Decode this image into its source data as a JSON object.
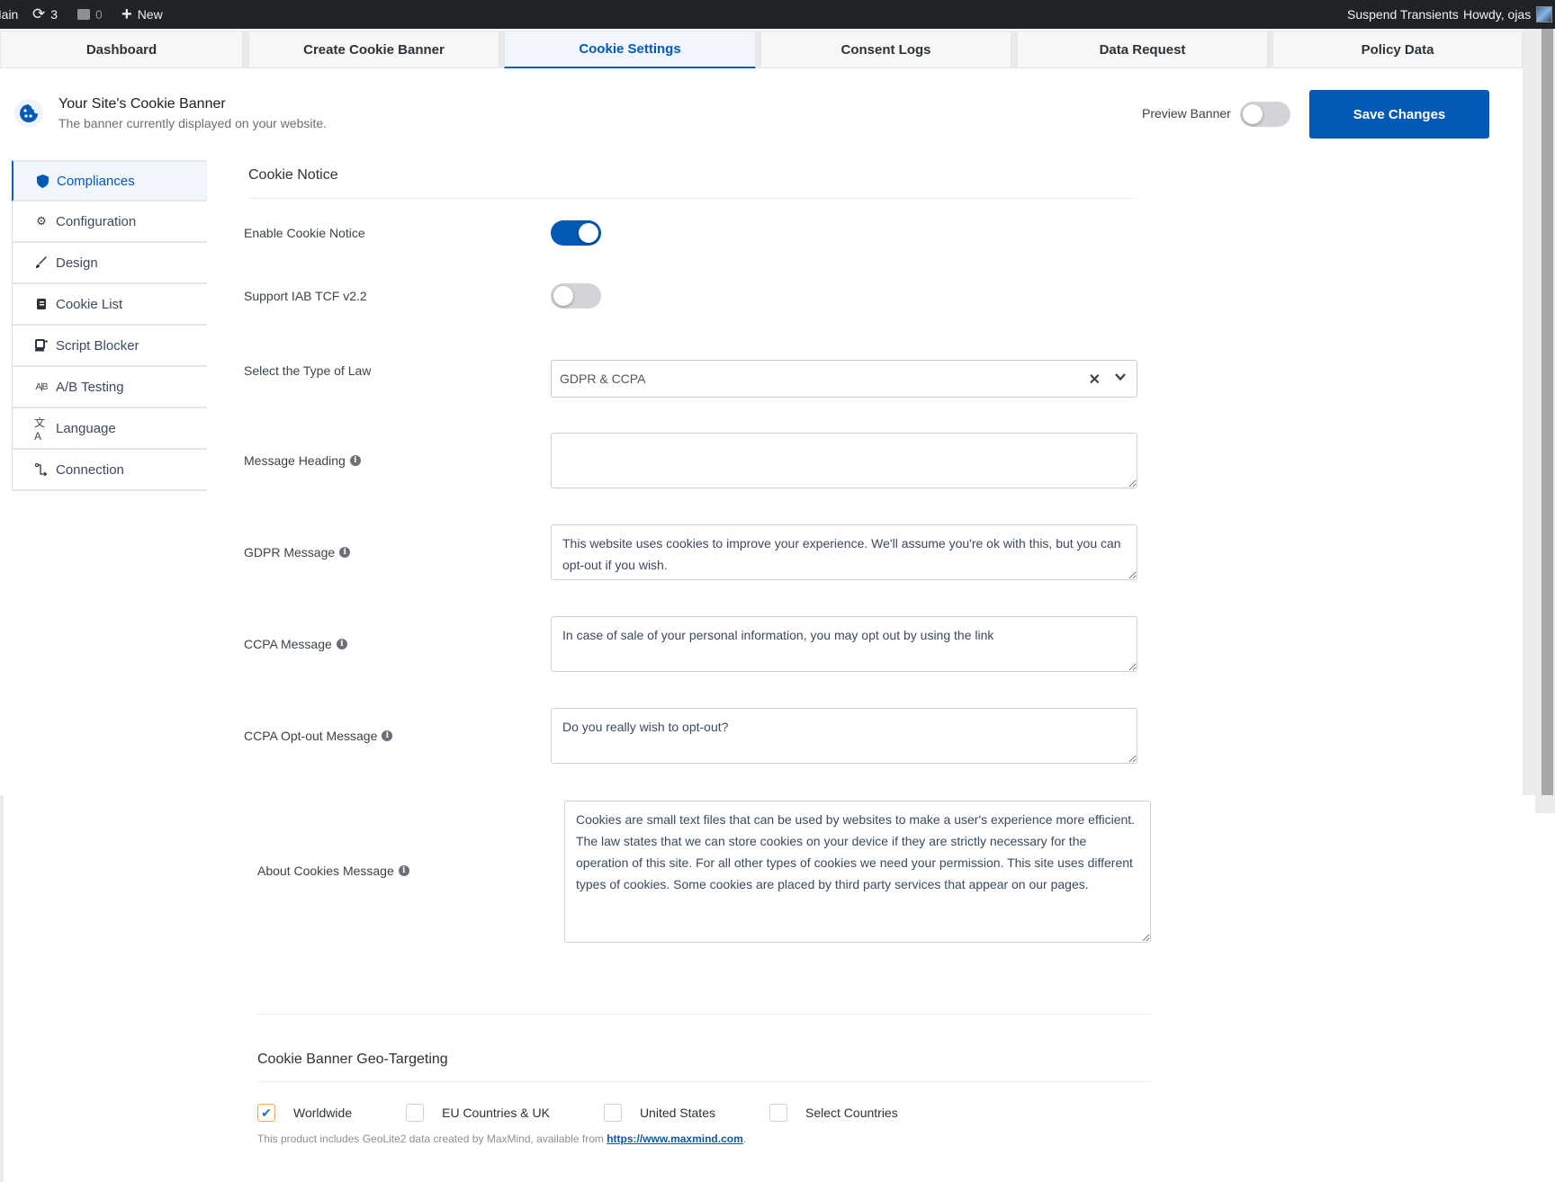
{
  "admin_bar": {
    "site_name": "Main",
    "updates_count": "3",
    "comments_count": "0",
    "new_label": "New",
    "suspend_label": "Suspend Transients",
    "howdy_label": "Howdy, ojas"
  },
  "tabs": [
    {
      "label": "Dashboard",
      "active": false
    },
    {
      "label": "Create Cookie Banner",
      "active": false
    },
    {
      "label": "Cookie Settings",
      "active": true
    },
    {
      "label": "Consent Logs",
      "active": false
    },
    {
      "label": "Data Request",
      "active": false
    },
    {
      "label": "Policy Data",
      "active": false
    }
  ],
  "header": {
    "title": "Your Site's Cookie Banner",
    "subtitle": "The banner currently displayed on your website.",
    "preview_label": "Preview Banner",
    "preview_enabled": false,
    "save_label": "Save Changes"
  },
  "sidebar": {
    "items": [
      {
        "label": "Compliances",
        "icon": "shield-icon",
        "active": true
      },
      {
        "label": "Configuration",
        "icon": "gears-icon",
        "active": false
      },
      {
        "label": "Design",
        "icon": "brush-icon",
        "active": false
      },
      {
        "label": "Cookie List",
        "icon": "scroll-icon",
        "active": false
      },
      {
        "label": "Script Blocker",
        "icon": "script-icon",
        "active": false
      },
      {
        "label": "A/B Testing",
        "icon": "ab-icon",
        "active": false
      },
      {
        "label": "Language",
        "icon": "translate-icon",
        "active": false
      },
      {
        "label": "Connection",
        "icon": "connection-icon",
        "active": false
      }
    ]
  },
  "cookie_notice": {
    "title": "Cookie Notice",
    "enable_label": "Enable Cookie Notice",
    "enable_on": true,
    "iab_label": "Support IAB TCF v2.2",
    "iab_on": false,
    "law_label": "Select the Type of Law",
    "law_value": "GDPR & CCPA",
    "heading_label": "Message Heading",
    "heading_value": "",
    "gdpr_label": "GDPR Message",
    "gdpr_value": "This website uses cookies to improve your experience. We'll assume you're ok with this, but you can opt-out if you wish.",
    "ccpa_label": "CCPA Message",
    "ccpa_value": "In case of sale of your personal information, you may opt out by using the link",
    "optout_label": "CCPA Opt-out Message",
    "optout_value": "Do you really wish to opt-out?",
    "about_label": "About Cookies Message",
    "about_value": "Cookies are small text files that can be used by websites to make a user's experience more efficient. The law states that we can store cookies on your device if they are strictly necessary for the operation of this site. For all other types of cookies we need your permission. This site uses different types of cookies. Some cookies are placed by third party services that appear on our pages."
  },
  "geo": {
    "title": "Cookie Banner Geo-Targeting",
    "options": [
      {
        "label": "Worldwide",
        "checked": true
      },
      {
        "label": "EU Countries & UK",
        "checked": false
      },
      {
        "label": "United States",
        "checked": false
      },
      {
        "label": "Select Countries",
        "checked": false
      }
    ],
    "note": "This product includes GeoLite2 data created by MaxMind, available from ",
    "link_text": "https://www.maxmind.com",
    "note_end": "."
  },
  "colors": {
    "accent": "#0459b4",
    "admin_bar": "#1d2327"
  }
}
